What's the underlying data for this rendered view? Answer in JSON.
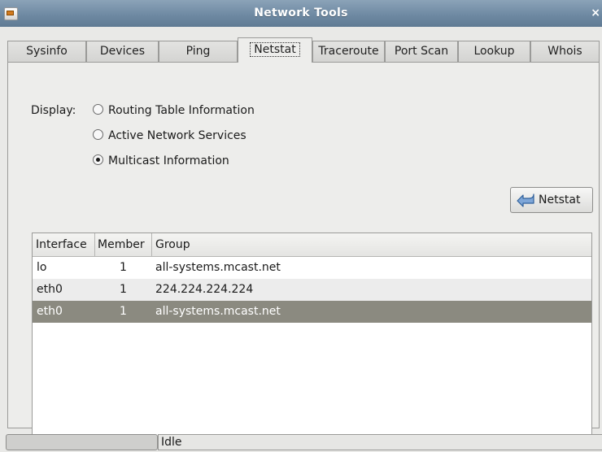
{
  "window": {
    "title": "Network Tools",
    "close_glyph": "×"
  },
  "tabs": [
    {
      "label": "Sysinfo"
    },
    {
      "label": "Devices"
    },
    {
      "label": "Ping"
    },
    {
      "label": "Netstat",
      "active": true
    },
    {
      "label": "Traceroute"
    },
    {
      "label": "Port Scan"
    },
    {
      "label": "Lookup"
    },
    {
      "label": "Whois"
    }
  ],
  "netstat": {
    "display_label": "Display:",
    "options": [
      {
        "label": "Routing Table Information",
        "checked": false
      },
      {
        "label": "Active Network Services",
        "checked": false
      },
      {
        "label": "Multicast Information",
        "checked": true
      }
    ],
    "button_label": "Netstat",
    "button_icon": "back-arrow-icon"
  },
  "table": {
    "columns": [
      "Interface",
      "Member",
      "Group"
    ],
    "rows": [
      {
        "interface": "lo",
        "member": "1",
        "group": "all-systems.mcast.net"
      },
      {
        "interface": "eth0",
        "member": "1",
        "group": "224.224.224.224"
      },
      {
        "interface": "eth0",
        "member": "1",
        "group": "all-systems.mcast.net",
        "selected": true
      }
    ]
  },
  "status": {
    "text": "Idle"
  },
  "colors": {
    "titlebar": "#6f8aa3",
    "selection": "#8b8a80",
    "background": "#ededeb"
  }
}
